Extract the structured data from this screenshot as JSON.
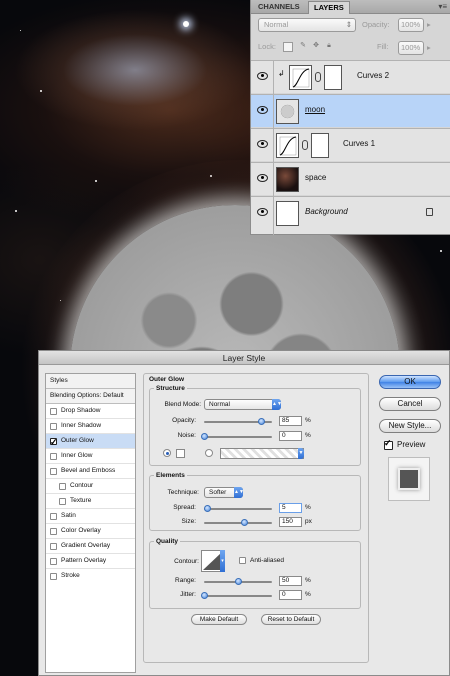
{
  "layers_panel": {
    "tabs": [
      "CHANNELS",
      "LAYERS"
    ],
    "active_tab": "LAYERS",
    "blend_mode": "Normal",
    "opacity_label": "Opacity:",
    "opacity_value": "100%",
    "lock_label": "Lock:",
    "fill_label": "Fill:",
    "fill_value": "100%",
    "layers": [
      {
        "name": "Curves 2",
        "type": "adjustment",
        "selected": false
      },
      {
        "name": "moon",
        "type": "image",
        "selected": true
      },
      {
        "name": "Curves 1",
        "type": "adjustment",
        "selected": false
      },
      {
        "name": "space",
        "type": "image",
        "selected": false
      },
      {
        "name": "Background",
        "type": "background",
        "selected": false
      }
    ]
  },
  "dialog": {
    "title": "Layer Style",
    "styles_header": "Styles",
    "styles": [
      {
        "label": "Blending Options: Default",
        "checkbox": false,
        "checked": false,
        "active": false
      },
      {
        "label": "Drop Shadow",
        "checkbox": true,
        "checked": false,
        "active": false
      },
      {
        "label": "Inner Shadow",
        "checkbox": true,
        "checked": false,
        "active": false
      },
      {
        "label": "Outer Glow",
        "checkbox": true,
        "checked": true,
        "active": true
      },
      {
        "label": "Inner Glow",
        "checkbox": true,
        "checked": false,
        "active": false
      },
      {
        "label": "Bevel and Emboss",
        "checkbox": true,
        "checked": false,
        "active": false
      },
      {
        "label": "Contour",
        "checkbox": true,
        "checked": false,
        "active": false,
        "indent": true
      },
      {
        "label": "Texture",
        "checkbox": true,
        "checked": false,
        "active": false,
        "indent": true
      },
      {
        "label": "Satin",
        "checkbox": true,
        "checked": false,
        "active": false
      },
      {
        "label": "Color Overlay",
        "checkbox": true,
        "checked": false,
        "active": false
      },
      {
        "label": "Gradient Overlay",
        "checkbox": true,
        "checked": false,
        "active": false
      },
      {
        "label": "Pattern Overlay",
        "checkbox": true,
        "checked": false,
        "active": false
      },
      {
        "label": "Stroke",
        "checkbox": true,
        "checked": false,
        "active": false
      }
    ],
    "outer_glow": {
      "heading": "Outer Glow",
      "structure": {
        "heading": "Structure",
        "blend_mode_label": "Blend Mode:",
        "blend_mode": "Normal",
        "opacity_label": "Opacity:",
        "opacity": "85",
        "opacity_fraction": 0.85,
        "noise_label": "Noise:",
        "noise": "0",
        "noise_fraction": 0.0,
        "unit": "%"
      },
      "elements": {
        "heading": "Elements",
        "technique_label": "Technique:",
        "technique": "Softer",
        "spread_label": "Spread:",
        "spread": "5",
        "spread_fraction": 0.05,
        "spread_unit": "%",
        "size_label": "Size:",
        "size": "150",
        "size_fraction": 0.6,
        "size_unit": "px"
      },
      "quality": {
        "heading": "Quality",
        "contour_label": "Contour:",
        "anti_aliased_label": "Anti-aliased",
        "range_label": "Range:",
        "range": "50",
        "range_fraction": 0.5,
        "range_unit": "%",
        "jitter_label": "Jitter:",
        "jitter": "0",
        "jitter_fraction": 0.0,
        "jitter_unit": "%"
      },
      "make_default": "Make Default",
      "reset_default": "Reset to Default"
    },
    "buttons": {
      "ok": "OK",
      "cancel": "Cancel",
      "new_style": "New Style...",
      "preview_label": "Preview",
      "preview_checked": true
    }
  },
  "colors": {
    "selection_blue": "#b8d4f8",
    "accent_blue": "#3f82e6"
  }
}
